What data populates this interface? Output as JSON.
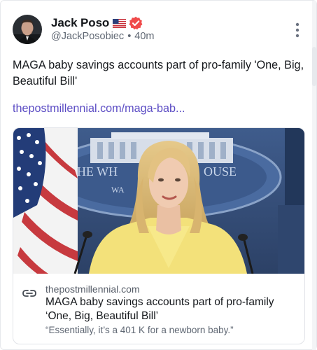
{
  "author": {
    "name": "Jack Poso",
    "handle": "@JackPosobiec",
    "separator": "•",
    "time": "40m",
    "flag_icon": "us-flag-icon",
    "verified_icon": "verified-badge-icon"
  },
  "post": {
    "text": "MAGA baby savings accounts part of pro-family 'One, Big, Beautiful Bill'",
    "link_text": "thepostmillennial.com/maga-bab..."
  },
  "card": {
    "domain": "thepostmillennial.com",
    "title": "MAGA baby savings accounts part of pro-family ‘One, Big, Beautiful Bill’",
    "description": "“Essentially, it’s a 401 K for a newborn baby.”",
    "image_caption_text": "THE WHITE HOUSE",
    "podium_text": "WA"
  },
  "colors": {
    "link": "#5b4cc4",
    "verified": "#f04a4a",
    "text": "#15181c",
    "muted": "#5f6773"
  }
}
